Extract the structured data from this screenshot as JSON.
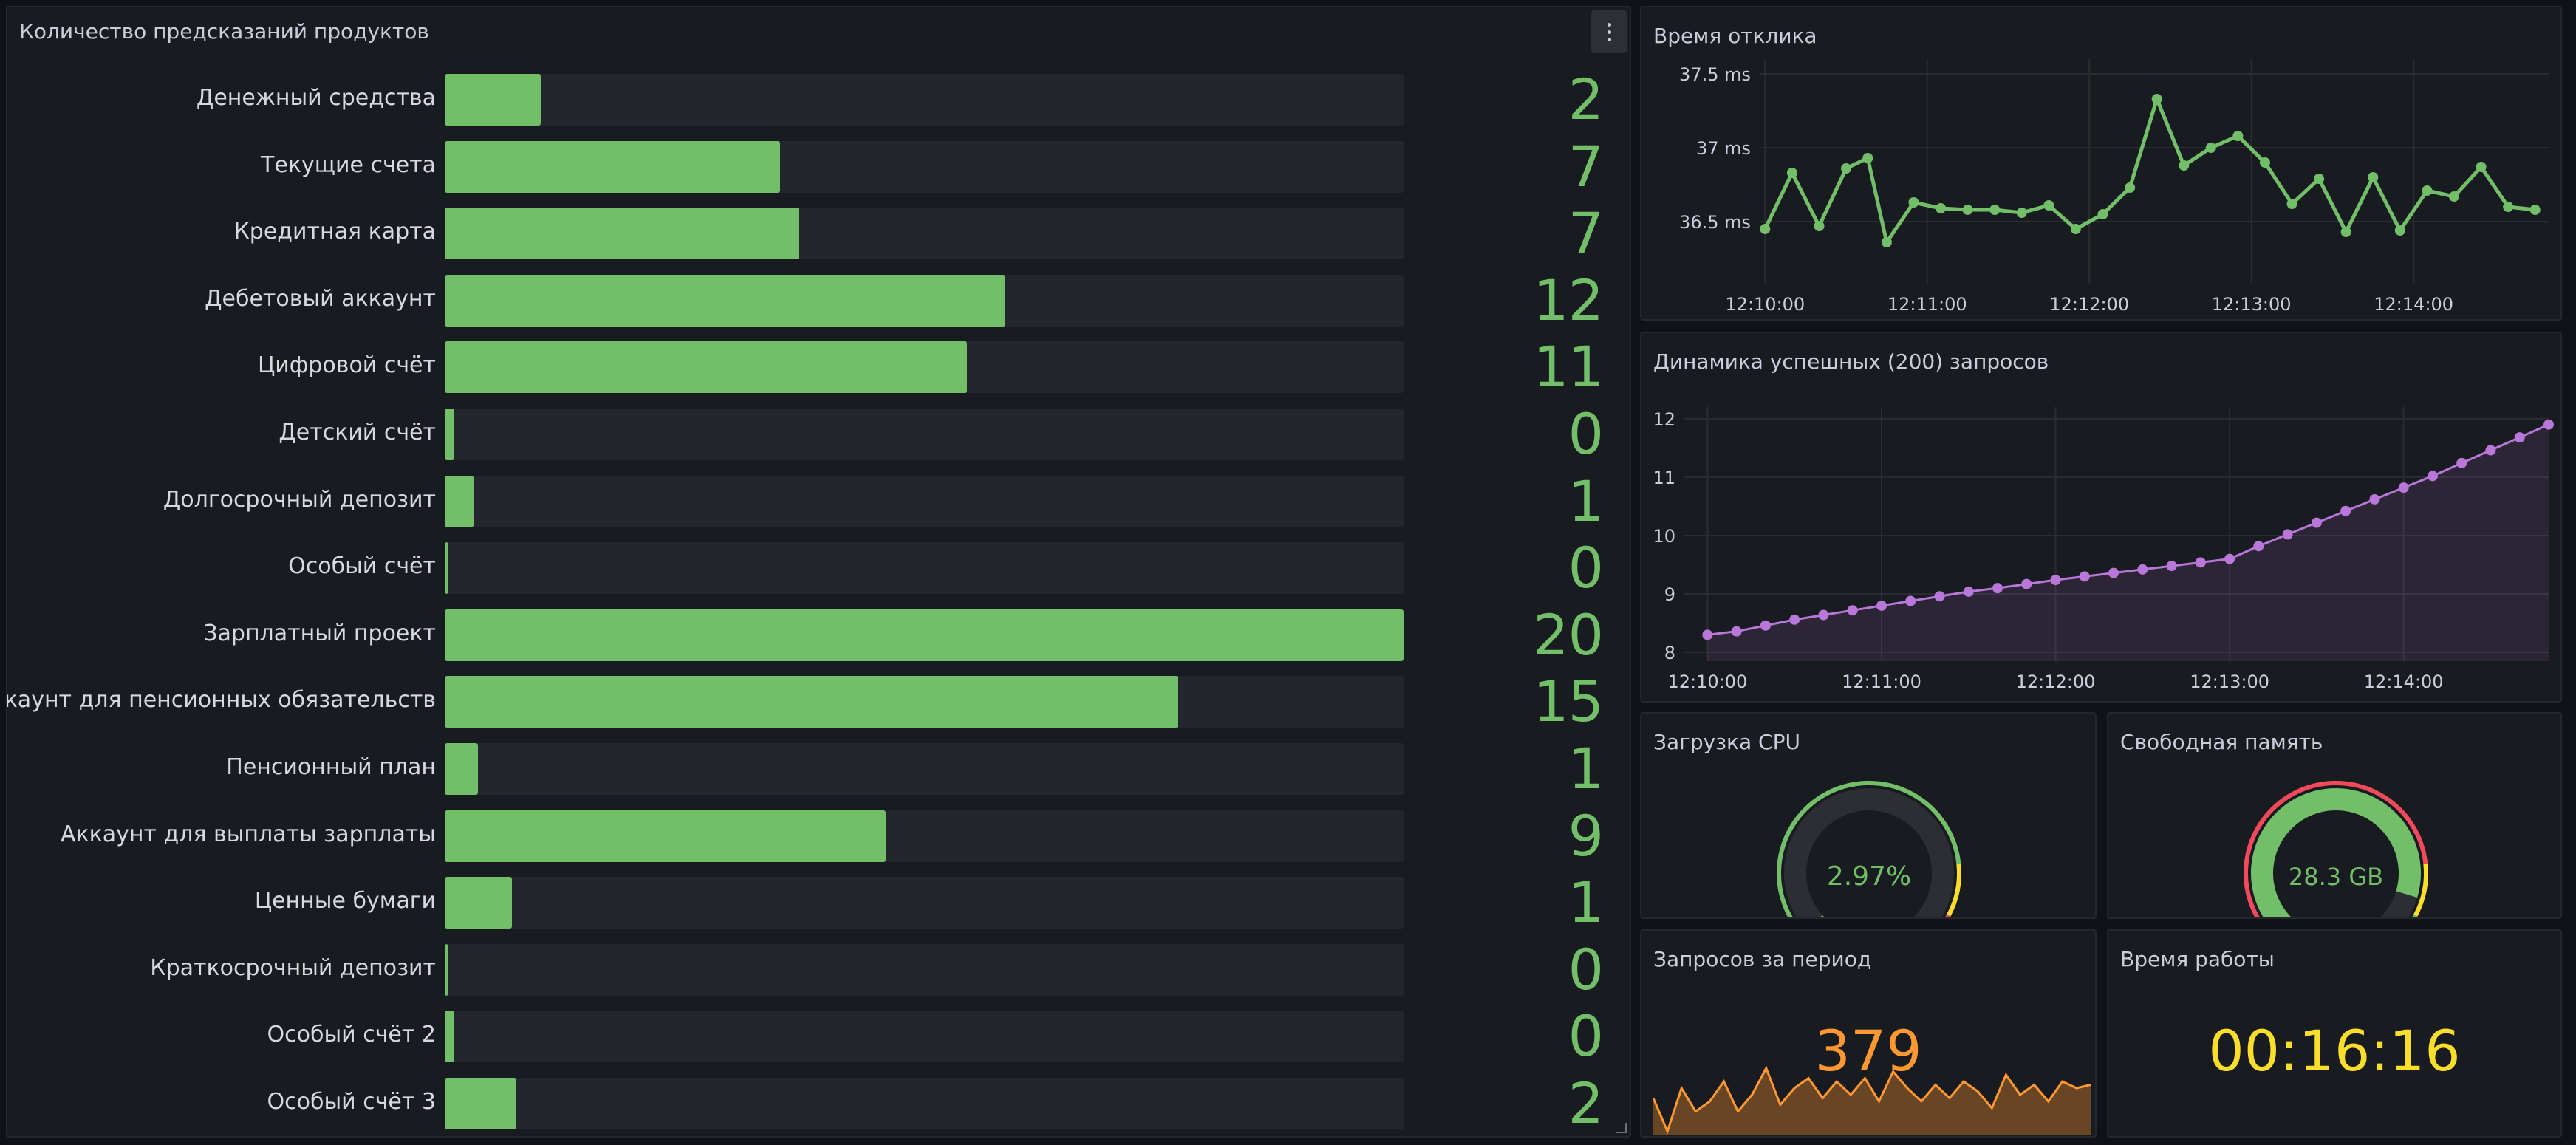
{
  "bars_panel": {
    "title": "Количество предсказаний продуктов",
    "max": 20,
    "color": "#73bf69",
    "items": [
      {
        "label": "Денежный средства",
        "value": "2",
        "n": 2
      },
      {
        "label": "Текущие счета",
        "value": "7",
        "n": 7
      },
      {
        "label": "Кредитная карта",
        "value": "7",
        "n": 7.4
      },
      {
        "label": "Дебетовый аккаунт",
        "value": "12",
        "n": 11.7
      },
      {
        "label": "Цифровой счёт",
        "value": "11",
        "n": 10.9
      },
      {
        "label": "Детский счёт",
        "value": "0",
        "n": 0.2
      },
      {
        "label": "Долгосрочный депозит",
        "value": "1",
        "n": 0.6
      },
      {
        "label": "Особый счёт",
        "value": "0",
        "n": 0.05
      },
      {
        "label": "Зарплатный проект",
        "value": "20",
        "n": 20
      },
      {
        "label": "Аккаунт для пенсионных обязательств",
        "value": "15",
        "n": 15.3
      },
      {
        "label": "Пенсионный план",
        "value": "1",
        "n": 0.7
      },
      {
        "label": "Аккаунт для выплаты зарплаты",
        "value": "9",
        "n": 9.2
      },
      {
        "label": "Ценные бумаги",
        "value": "1",
        "n": 1.4
      },
      {
        "label": "Краткосрочный депозит",
        "value": "0",
        "n": 0.05
      },
      {
        "label": "Особый счёт 2",
        "value": "0",
        "n": 0.2
      },
      {
        "label": "Особый счёт 3",
        "value": "2",
        "n": 1.5
      }
    ]
  },
  "latency_panel": {
    "title": "Время отклика",
    "chart_data": {
      "type": "line",
      "color": "#73bf69",
      "yticks": [
        "36.5 ms",
        "37 ms",
        "37.5 ms"
      ],
      "ytick_values": [
        36.5,
        37,
        37.5
      ],
      "ylim": [
        36.08,
        37.6
      ],
      "xticks": [
        "12:10:00",
        "12:11:00",
        "12:12:00",
        "12:13:00",
        "12:14:00"
      ],
      "xtick_pos": [
        0,
        60,
        120,
        180,
        240
      ],
      "xlim": [
        -2,
        290
      ],
      "x": [
        0,
        10,
        20,
        30,
        38,
        45,
        55,
        65,
        75,
        85,
        95,
        105,
        115,
        125,
        135,
        145,
        155,
        165,
        175,
        185,
        195,
        205,
        215,
        225,
        235,
        245,
        255,
        265,
        275,
        285
      ],
      "y": [
        36.45,
        36.83,
        36.47,
        36.86,
        36.93,
        36.36,
        36.63,
        36.59,
        36.58,
        36.58,
        36.56,
        36.61,
        36.45,
        36.55,
        36.73,
        37.33,
        36.88,
        37.0,
        37.08,
        36.9,
        36.62,
        36.79,
        36.43,
        36.8,
        36.44,
        36.71,
        36.67,
        36.87,
        36.6,
        36.58
      ]
    }
  },
  "success_panel": {
    "title": "Динамика успешных (200) запросов",
    "chart_data": {
      "type": "area",
      "color": "#b877d9",
      "yticks": [
        "8",
        "9",
        "10",
        "11",
        "12"
      ],
      "ytick_values": [
        8,
        9,
        10,
        11,
        12
      ],
      "ylim": [
        7.85,
        12.2
      ],
      "xticks": [
        "12:10:00",
        "12:11:00",
        "12:12:00",
        "12:13:00",
        "12:14:00"
      ],
      "xtick_pos": [
        0,
        60,
        120,
        180,
        240
      ],
      "xlim": [
        -8,
        290
      ],
      "x": [
        0,
        10,
        20,
        30,
        40,
        50,
        60,
        70,
        80,
        90,
        100,
        110,
        120,
        130,
        140,
        150,
        160,
        170,
        180,
        190,
        200,
        210,
        220,
        230,
        240,
        250,
        260,
        270,
        280,
        290
      ],
      "y": [
        8.3,
        8.36,
        8.46,
        8.56,
        8.64,
        8.72,
        8.8,
        8.88,
        8.96,
        9.04,
        9.1,
        9.17,
        9.24,
        9.3,
        9.36,
        9.42,
        9.48,
        9.54,
        9.6,
        9.82,
        10.02,
        10.22,
        10.42,
        10.62,
        10.82,
        11.02,
        11.24,
        11.46,
        11.68,
        11.9
      ]
    }
  },
  "cpu_panel": {
    "title": "Загрузка CPU",
    "value": "2.97%",
    "fraction": 0.0297,
    "color": "#73bf69",
    "threshold_colors": [
      "#73bf69",
      "#fade2a",
      "#f2495c"
    ]
  },
  "mem_panel": {
    "title": "Свободная память",
    "value": "28.3 GB",
    "fraction": 0.88,
    "color": "#73bf69",
    "threshold_colors": [
      "#f2495c",
      "#fade2a",
      "#73bf69"
    ]
  },
  "req_panel": {
    "title": "Запросов за период",
    "value": "379",
    "color": "#ff9830",
    "chart_data": {
      "type": "area",
      "y": [
        0.55,
        0.05,
        0.7,
        0.35,
        0.5,
        0.8,
        0.35,
        0.6,
        1.0,
        0.45,
        0.7,
        0.85,
        0.55,
        0.8,
        0.6,
        0.85,
        0.5,
        0.95,
        0.7,
        0.5,
        0.75,
        0.55,
        0.8,
        0.65,
        0.4,
        0.9,
        0.6,
        0.75,
        0.5,
        0.8,
        0.7,
        0.75
      ]
    }
  },
  "uptime_panel": {
    "title": "Время работы",
    "value": "00:16:16",
    "color": "#fade2a"
  }
}
